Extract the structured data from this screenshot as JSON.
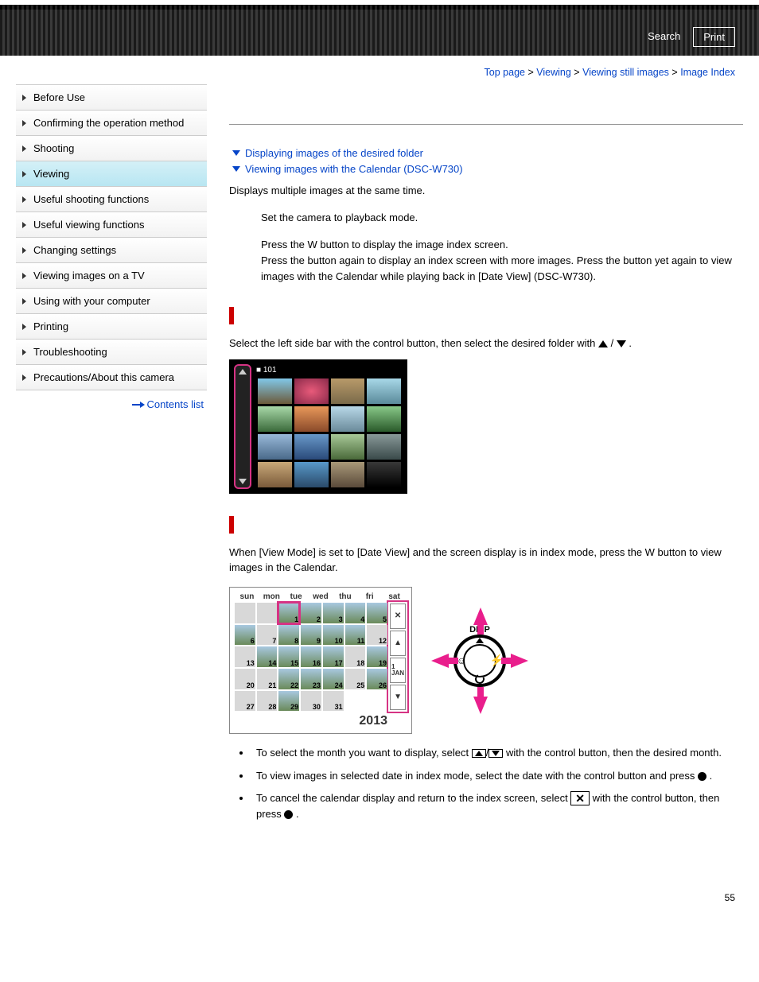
{
  "banner": {
    "search": "Search",
    "print": "Print"
  },
  "breadcrumb": {
    "items": [
      "Top page",
      "Viewing",
      "Viewing still images",
      "Image Index"
    ],
    "sep": ">"
  },
  "sidebar": {
    "items": [
      "Before Use",
      "Confirming the operation method",
      "Shooting",
      "Viewing",
      "Useful shooting functions",
      "Useful viewing functions",
      "Changing settings",
      "Viewing images on a TV",
      "Using with your computer",
      "Printing",
      "Troubleshooting",
      "Precautions/About this camera"
    ],
    "active_index": 3,
    "contents_list": "Contents list"
  },
  "content": {
    "anchors": [
      "Displaying images of the desired folder",
      "Viewing images with the Calendar (DSC-W730)"
    ],
    "intro": "Displays multiple images at the same time.",
    "steps": [
      "Set the camera to playback mode.",
      "Press the W button to display the image index screen.\nPress the button again to display an index screen with more images. Press the button yet again to view images with the Calendar while playing back in [Date View] (DSC-W730)."
    ],
    "folder_section": {
      "text_before": "Select the left side bar with the control button, then select the desired folder with ",
      "text_mid": " / ",
      "text_after": " .",
      "folder_tag": "101"
    },
    "calendar_section": {
      "intro": "When [View Mode] is set to [Date View] and the screen display is in index mode, press the W button to view images in the Calendar.",
      "days": [
        "sun",
        "mon",
        "tue",
        "wed",
        "thu",
        "fri",
        "sat"
      ],
      "year": "2013",
      "side_labels": [
        "✕",
        "▲",
        "1\nJAN",
        "▼"
      ],
      "dial_label": "DISP",
      "bullets": [
        {
          "pre": "To select the month you want to display, select ",
          "mid": "/",
          "post": " with the control button, then the desired month."
        },
        {
          "pre": "To view images in selected date in index mode, select the date with the control button and press ",
          "post": " ."
        },
        {
          "pre": "To cancel the calendar display and return to the index screen, select ",
          "post": " with the control button, then press ",
          "post2": " ."
        }
      ]
    }
  },
  "page_number": "55"
}
